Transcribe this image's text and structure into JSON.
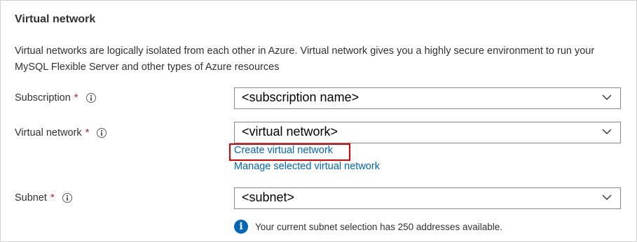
{
  "section": {
    "title": "Virtual network",
    "description": "Virtual networks are logically isolated from each other in Azure. Virtual network gives you a highly secure environment to run your MySQL Flexible Server and other types of Azure resources"
  },
  "fields": {
    "subscription": {
      "label": "Subscription",
      "required_mark": "*",
      "value": "<subscription name>"
    },
    "virtual_network": {
      "label": "Virtual network",
      "required_mark": "*",
      "value": "<virtual network>"
    },
    "subnet": {
      "label": "Subnet",
      "required_mark": "*",
      "value": "<subnet>"
    }
  },
  "links": {
    "create": "Create virtual network",
    "manage": "Manage selected virtual network"
  },
  "note": {
    "text": "Your current subnet selection has 250 addresses available."
  },
  "colors": {
    "link": "#0067b8",
    "required": "#a4262c",
    "highlight": "#e00000",
    "info_badge": "#0067b8"
  },
  "icons": {
    "info": "info-icon",
    "chevron": "chevron-down-icon",
    "note": "info-filled-icon"
  }
}
